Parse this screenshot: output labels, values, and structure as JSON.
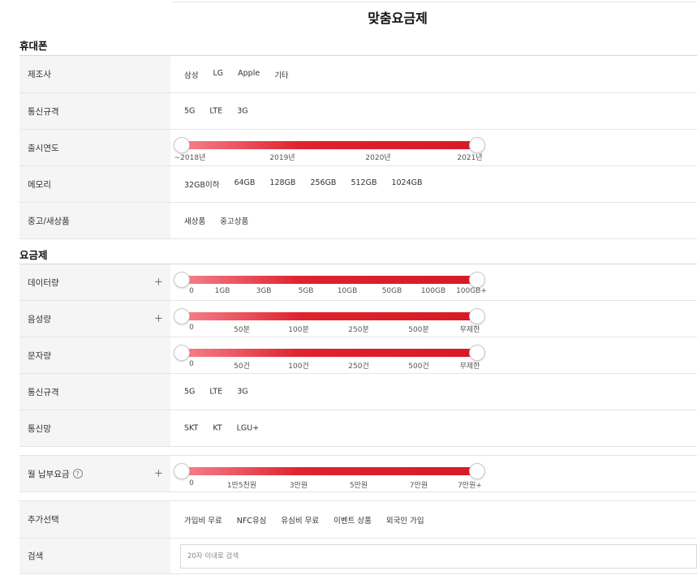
{
  "page_title": "맞춤요금제",
  "sections": {
    "phone": "휴대폰",
    "plan": "요금제"
  },
  "phone": {
    "manufacturer": {
      "label": "제조사",
      "options": [
        "삼성",
        "LG",
        "Apple",
        "기타"
      ]
    },
    "network_spec": {
      "label": "통신규격",
      "options": [
        "5G",
        "LTE",
        "3G"
      ]
    },
    "release_year": {
      "label": "출시연도",
      "ticks": [
        "~2018년",
        "2019년",
        "2020년",
        "2021년"
      ],
      "range": [
        0,
        1
      ]
    },
    "memory": {
      "label": "메모리",
      "options": [
        "32GB이하",
        "64GB",
        "128GB",
        "256GB",
        "512GB",
        "1024GB"
      ]
    },
    "condition": {
      "label": "중고/새상품",
      "options": [
        "새상품",
        "중고상품"
      ]
    }
  },
  "plan": {
    "data": {
      "label": "데이터량",
      "expand_icon": "plus-icon",
      "ticks": [
        "0",
        "1GB",
        "3GB",
        "5GB",
        "10GB",
        "50GB",
        "100GB",
        "100GB+"
      ],
      "range": [
        0,
        1
      ]
    },
    "voice": {
      "label": "음성량",
      "expand_icon": "plus-icon",
      "ticks": [
        "0",
        "50분",
        "100분",
        "250분",
        "500분",
        "무제한"
      ],
      "range": [
        0,
        1
      ]
    },
    "sms": {
      "label": "문자량",
      "ticks": [
        "0",
        "50건",
        "100건",
        "250건",
        "500건",
        "무제한"
      ],
      "range": [
        0,
        1
      ]
    },
    "network_spec": {
      "label": "통신규격",
      "options": [
        "5G",
        "LTE",
        "3G"
      ]
    },
    "carrier": {
      "label": "통신망",
      "options": [
        "SKT",
        "KT",
        "LGU+"
      ]
    },
    "monthly_fee": {
      "label": "월 납부요금",
      "help_icon": "?",
      "expand_icon": "plus-icon",
      "ticks": [
        "0",
        "1만5천원",
        "3만원",
        "5만원",
        "7만원",
        "7만원+"
      ],
      "range": [
        0,
        1
      ]
    },
    "extra": {
      "label": "추가선택",
      "options": [
        "가입비 무료",
        "NFC유심",
        "유심비 무료",
        "이벤트 상품",
        "외국인 가입"
      ]
    },
    "search": {
      "label": "검색",
      "placeholder": "20자 이내로 검색"
    }
  },
  "colors": {
    "slider_start": "#f5828c",
    "slider_end": "#d81a27",
    "label_bg": "#f5f5f5"
  }
}
